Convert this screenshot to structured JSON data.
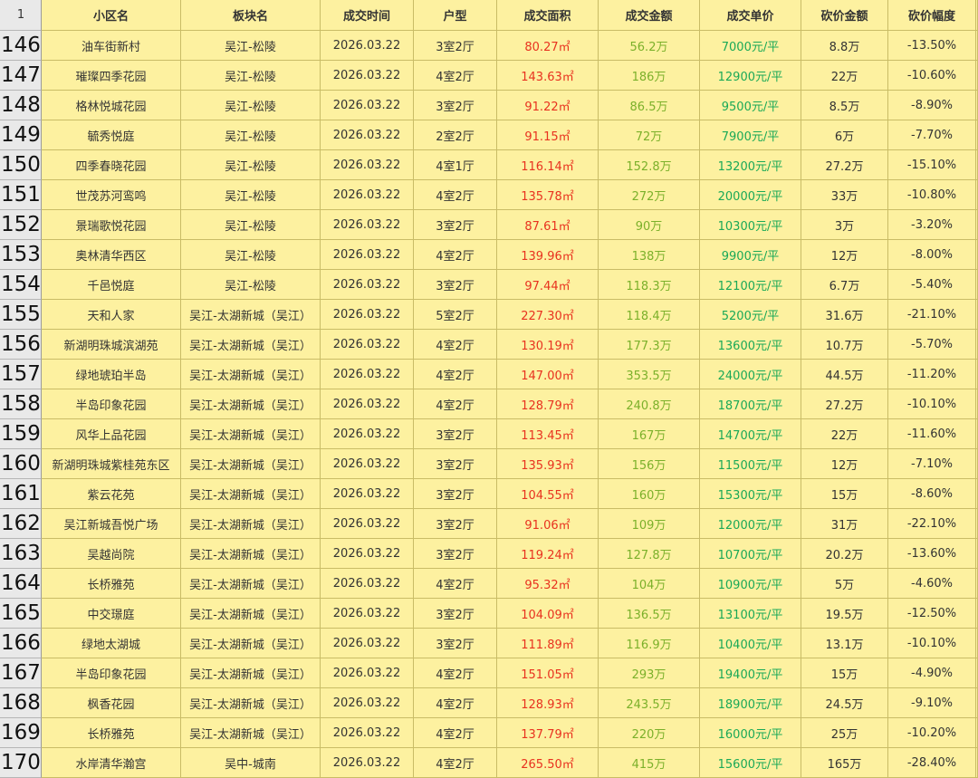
{
  "colors": {
    "sheet_bg": "#fdf1a0",
    "grid": "#c9bc66",
    "rownum_bg": "#e9e9e9",
    "area_text": "#e8321f",
    "amount_text": "#7bb02a",
    "unit_price_text": "#1aa957",
    "default_text": "#333333"
  },
  "header": {
    "row_number": "1",
    "community": "小区名",
    "district": "板块名",
    "date": "成交时间",
    "layout": "户型",
    "area": "成交面积",
    "amount": "成交金额",
    "unit_price": "成交单价",
    "cut_amount": "砍价金额",
    "cut_rate": "砍价幅度"
  },
  "rows": [
    {
      "n": "146",
      "community": "油车街新村",
      "district": "吴江-松陵",
      "date": "2026.03.22",
      "layout": "3室2厅",
      "area": "80.27㎡",
      "amount": "56.2万",
      "unit_price": "7000元/平",
      "cut_amount": "8.8万",
      "cut_rate": "-13.50%"
    },
    {
      "n": "147",
      "community": "璀璨四季花园",
      "district": "吴江-松陵",
      "date": "2026.03.22",
      "layout": "4室2厅",
      "area": "143.63㎡",
      "amount": "186万",
      "unit_price": "12900元/平",
      "cut_amount": "22万",
      "cut_rate": "-10.60%"
    },
    {
      "n": "148",
      "community": "格林悦城花园",
      "district": "吴江-松陵",
      "date": "2026.03.22",
      "layout": "3室2厅",
      "area": "91.22㎡",
      "amount": "86.5万",
      "unit_price": "9500元/平",
      "cut_amount": "8.5万",
      "cut_rate": "-8.90%"
    },
    {
      "n": "149",
      "community": "毓秀悦庭",
      "district": "吴江-松陵",
      "date": "2026.03.22",
      "layout": "2室2厅",
      "area": "91.15㎡",
      "amount": "72万",
      "unit_price": "7900元/平",
      "cut_amount": "6万",
      "cut_rate": "-7.70%"
    },
    {
      "n": "150",
      "community": "四季春晓花园",
      "district": "吴江-松陵",
      "date": "2026.03.22",
      "layout": "4室1厅",
      "area": "116.14㎡",
      "amount": "152.8万",
      "unit_price": "13200元/平",
      "cut_amount": "27.2万",
      "cut_rate": "-15.10%"
    },
    {
      "n": "151",
      "community": "世茂苏河鸾鸣",
      "district": "吴江-松陵",
      "date": "2026.03.22",
      "layout": "4室2厅",
      "area": "135.78㎡",
      "amount": "272万",
      "unit_price": "20000元/平",
      "cut_amount": "33万",
      "cut_rate": "-10.80%"
    },
    {
      "n": "152",
      "community": "景瑞歌悦花园",
      "district": "吴江-松陵",
      "date": "2026.03.22",
      "layout": "3室2厅",
      "area": "87.61㎡",
      "amount": "90万",
      "unit_price": "10300元/平",
      "cut_amount": "3万",
      "cut_rate": "-3.20%"
    },
    {
      "n": "153",
      "community": "奥林清华西区",
      "district": "吴江-松陵",
      "date": "2026.03.22",
      "layout": "4室2厅",
      "area": "139.96㎡",
      "amount": "138万",
      "unit_price": "9900元/平",
      "cut_amount": "12万",
      "cut_rate": "-8.00%"
    },
    {
      "n": "154",
      "community": "千邑悦庭",
      "district": "吴江-松陵",
      "date": "2026.03.22",
      "layout": "3室2厅",
      "area": "97.44㎡",
      "amount": "118.3万",
      "unit_price": "12100元/平",
      "cut_amount": "6.7万",
      "cut_rate": "-5.40%"
    },
    {
      "n": "155",
      "community": "天和人家",
      "district": "吴江-太湖新城（吴江）",
      "date": "2026.03.22",
      "layout": "5室2厅",
      "area": "227.30㎡",
      "amount": "118.4万",
      "unit_price": "5200元/平",
      "cut_amount": "31.6万",
      "cut_rate": "-21.10%"
    },
    {
      "n": "156",
      "community": "新湖明珠城滨湖苑",
      "district": "吴江-太湖新城（吴江）",
      "date": "2026.03.22",
      "layout": "4室2厅",
      "area": "130.19㎡",
      "amount": "177.3万",
      "unit_price": "13600元/平",
      "cut_amount": "10.7万",
      "cut_rate": "-5.70%"
    },
    {
      "n": "157",
      "community": "绿地琥珀半岛",
      "district": "吴江-太湖新城（吴江）",
      "date": "2026.03.22",
      "layout": "4室2厅",
      "area": "147.00㎡",
      "amount": "353.5万",
      "unit_price": "24000元/平",
      "cut_amount": "44.5万",
      "cut_rate": "-11.20%"
    },
    {
      "n": "158",
      "community": "半岛印象花园",
      "district": "吴江-太湖新城（吴江）",
      "date": "2026.03.22",
      "layout": "4室2厅",
      "area": "128.79㎡",
      "amount": "240.8万",
      "unit_price": "18700元/平",
      "cut_amount": "27.2万",
      "cut_rate": "-10.10%"
    },
    {
      "n": "159",
      "community": "风华上品花园",
      "district": "吴江-太湖新城（吴江）",
      "date": "2026.03.22",
      "layout": "3室2厅",
      "area": "113.45㎡",
      "amount": "167万",
      "unit_price": "14700元/平",
      "cut_amount": "22万",
      "cut_rate": "-11.60%"
    },
    {
      "n": "160",
      "community": "新湖明珠城紫桂苑东区",
      "district": "吴江-太湖新城（吴江）",
      "date": "2026.03.22",
      "layout": "3室2厅",
      "area": "135.93㎡",
      "amount": "156万",
      "unit_price": "11500元/平",
      "cut_amount": "12万",
      "cut_rate": "-7.10%"
    },
    {
      "n": "161",
      "community": "紫云花苑",
      "district": "吴江-太湖新城（吴江）",
      "date": "2026.03.22",
      "layout": "3室2厅",
      "area": "104.55㎡",
      "amount": "160万",
      "unit_price": "15300元/平",
      "cut_amount": "15万",
      "cut_rate": "-8.60%"
    },
    {
      "n": "162",
      "community": "吴江新城吾悦广场",
      "district": "吴江-太湖新城（吴江）",
      "date": "2026.03.22",
      "layout": "3室2厅",
      "area": "91.06㎡",
      "amount": "109万",
      "unit_price": "12000元/平",
      "cut_amount": "31万",
      "cut_rate": "-22.10%"
    },
    {
      "n": "163",
      "community": "吴越尚院",
      "district": "吴江-太湖新城（吴江）",
      "date": "2026.03.22",
      "layout": "3室2厅",
      "area": "119.24㎡",
      "amount": "127.8万",
      "unit_price": "10700元/平",
      "cut_amount": "20.2万",
      "cut_rate": "-13.60%"
    },
    {
      "n": "164",
      "community": "长桥雅苑",
      "district": "吴江-太湖新城（吴江）",
      "date": "2026.03.22",
      "layout": "4室2厅",
      "area": "95.32㎡",
      "amount": "104万",
      "unit_price": "10900元/平",
      "cut_amount": "5万",
      "cut_rate": "-4.60%"
    },
    {
      "n": "165",
      "community": "中交璟庭",
      "district": "吴江-太湖新城（吴江）",
      "date": "2026.03.22",
      "layout": "3室2厅",
      "area": "104.09㎡",
      "amount": "136.5万",
      "unit_price": "13100元/平",
      "cut_amount": "19.5万",
      "cut_rate": "-12.50%"
    },
    {
      "n": "166",
      "community": "绿地太湖城",
      "district": "吴江-太湖新城（吴江）",
      "date": "2026.03.22",
      "layout": "3室2厅",
      "area": "111.89㎡",
      "amount": "116.9万",
      "unit_price": "10400元/平",
      "cut_amount": "13.1万",
      "cut_rate": "-10.10%"
    },
    {
      "n": "167",
      "community": "半岛印象花园",
      "district": "吴江-太湖新城（吴江）",
      "date": "2026.03.22",
      "layout": "4室2厅",
      "area": "151.05㎡",
      "amount": "293万",
      "unit_price": "19400元/平",
      "cut_amount": "15万",
      "cut_rate": "-4.90%"
    },
    {
      "n": "168",
      "community": "枫香花园",
      "district": "吴江-太湖新城（吴江）",
      "date": "2026.03.22",
      "layout": "4室2厅",
      "area": "128.93㎡",
      "amount": "243.5万",
      "unit_price": "18900元/平",
      "cut_amount": "24.5万",
      "cut_rate": "-9.10%"
    },
    {
      "n": "169",
      "community": "长桥雅苑",
      "district": "吴江-太湖新城（吴江）",
      "date": "2026.03.22",
      "layout": "4室2厅",
      "area": "137.79㎡",
      "amount": "220万",
      "unit_price": "16000元/平",
      "cut_amount": "25万",
      "cut_rate": "-10.20%"
    },
    {
      "n": "170",
      "community": "水岸清华瀚宫",
      "district": "吴中-城南",
      "date": "2026.03.22",
      "layout": "4室2厅",
      "area": "265.50㎡",
      "amount": "415万",
      "unit_price": "15600元/平",
      "cut_amount": "165万",
      "cut_rate": "-28.40%"
    }
  ]
}
